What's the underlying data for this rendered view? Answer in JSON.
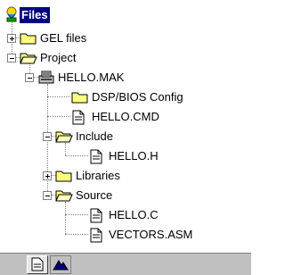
{
  "tree": {
    "root": {
      "label": "Files",
      "icon": "files-root-icon"
    },
    "gel_files": {
      "label": "GEL files",
      "icon": "folder-icon",
      "toggle": "+"
    },
    "project": {
      "label": "Project",
      "icon": "folder-open-icon",
      "toggle": "-"
    },
    "hello_mak": {
      "label": "HELLO.MAK",
      "icon": "project-file-icon",
      "toggle": "-"
    },
    "dspbios_config": {
      "label": "DSP/BIOS Config",
      "icon": "folder-icon"
    },
    "hello_cmd": {
      "label": "HELLO.CMD",
      "icon": "document-icon"
    },
    "include": {
      "label": "Include",
      "icon": "folder-open-icon",
      "toggle": "-"
    },
    "hello_h": {
      "label": "HELLO.H",
      "icon": "document-icon"
    },
    "libraries": {
      "label": "Libraries",
      "icon": "folder-icon",
      "toggle": "+"
    },
    "source": {
      "label": "Source",
      "icon": "folder-open-icon",
      "toggle": "-"
    },
    "hello_c": {
      "label": "HELLO.C",
      "icon": "document-icon"
    },
    "vectors_asm": {
      "label": "VECTORS.ASM",
      "icon": "document-icon"
    }
  },
  "tabs": [
    {
      "icon": "file-view-tab-icon",
      "active": true
    },
    {
      "icon": "bookmark-view-tab-icon",
      "active": false
    }
  ],
  "colors": {
    "selection": "#000080",
    "folder": "#ffff80",
    "tabbar": "#c0c0c0"
  }
}
